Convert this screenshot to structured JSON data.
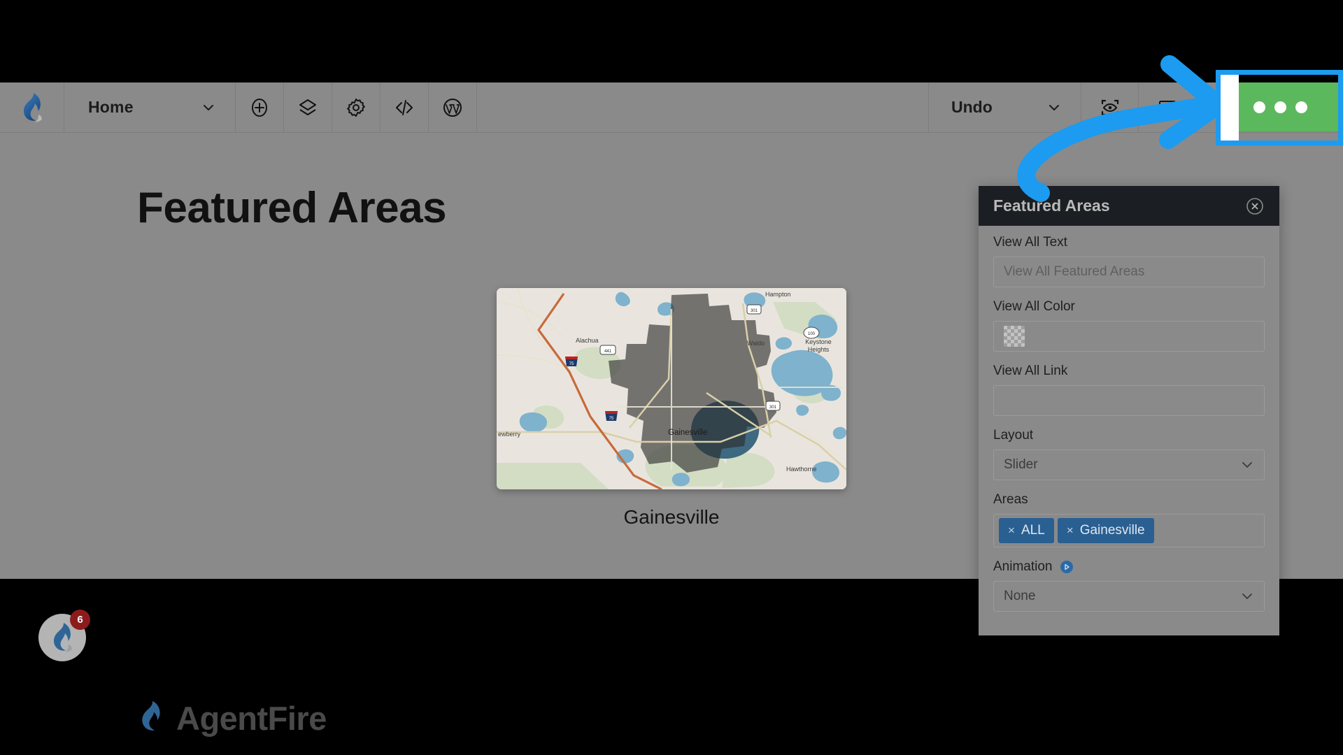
{
  "toolbar": {
    "logo_icon": "agentfire-flame-icon",
    "page_selector": {
      "label": "Home",
      "chevron_icon": "chevron-down-icon"
    },
    "tools": [
      {
        "name": "add-element-button",
        "icon": "plus-circle-icon"
      },
      {
        "name": "layers-button",
        "icon": "layers-icon"
      },
      {
        "name": "settings-button",
        "icon": "gear-icon"
      },
      {
        "name": "custom-code-button",
        "icon": "code-icon"
      },
      {
        "name": "wordpress-button",
        "icon": "wordpress-icon"
      }
    ],
    "undo": {
      "label": "Undo",
      "chevron_icon": "chevron-down-icon"
    },
    "preview_icon": "eye-preview-icon",
    "responsive_icon": "device-responsive-icon",
    "more_button": {
      "name": "more-options-button",
      "icon": "ellipsis-icon",
      "color": "#5cb85c"
    }
  },
  "canvas": {
    "page_title": "Featured Areas",
    "area_card": {
      "label": "Gainesville",
      "map": {
        "center_label": "Gainesville",
        "place_labels": [
          "Alachua",
          "Waldo",
          "Keystone Heights",
          "Newberry",
          "Hawthorne",
          "Hampton"
        ],
        "route_shields": [
          "441",
          "75",
          "301",
          "100",
          "301",
          "75"
        ]
      }
    }
  },
  "below_fold": {
    "avatar": {
      "icon": "agentfire-avatar-icon",
      "badge_count": "6"
    },
    "brand": {
      "icon": "agentfire-flame-icon",
      "name": "AgentFire"
    }
  },
  "panel": {
    "title": "Featured Areas",
    "close_icon": "close-circle-icon",
    "fields": {
      "view_all_text": {
        "label": "View All Text",
        "placeholder": "View All Featured Areas",
        "value": ""
      },
      "view_all_color": {
        "label": "View All Color",
        "swatch": "transparent-checkerboard"
      },
      "view_all_link": {
        "label": "View All Link",
        "placeholder": "",
        "value": ""
      },
      "layout": {
        "label": "Layout",
        "value": "Slider",
        "chevron_icon": "chevron-down-icon"
      },
      "areas": {
        "label": "Areas",
        "tags": [
          {
            "remove_icon": "×",
            "label": "ALL"
          },
          {
            "remove_icon": "×",
            "label": "Gainesville"
          }
        ]
      },
      "animation": {
        "label": "Animation",
        "play_icon": "play-circle-icon",
        "value": "None",
        "chevron_icon": "chevron-down-icon"
      }
    }
  },
  "annotation": {
    "arrow_color": "#1c9bf0",
    "highlight_color": "#1c9bf0",
    "target": "more-options-button"
  }
}
